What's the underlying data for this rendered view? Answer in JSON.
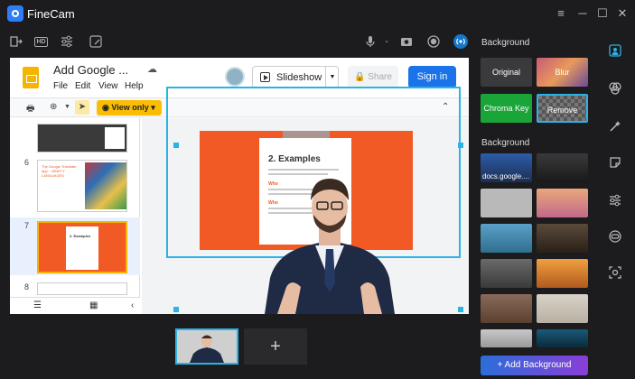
{
  "app": {
    "title": "FineCam"
  },
  "window": {
    "menu_icon": "≡",
    "minimize_icon": "─",
    "maximize_icon": "☐",
    "close_icon": "✕"
  },
  "toolbar": {
    "icons": [
      "exit-icon",
      "hd-icon",
      "adjust-icon",
      "edit-icon",
      "microphone-icon",
      "camera-icon",
      "record-icon",
      "broadcast-icon"
    ],
    "hd_label": "HD"
  },
  "slides_app": {
    "doc_title": "Add Google ...",
    "menu": [
      "File",
      "Edit",
      "View",
      "Help"
    ],
    "slideshow_label": "Slideshow",
    "share_label": "Share",
    "signin_label": "Sign in",
    "view_only_label": "View only",
    "thumbnails": [
      {
        "number": "6",
        "text": "The Google Translate app... NINETY LANGUAGES"
      },
      {
        "number": "7",
        "text": "2. Examples"
      },
      {
        "number": "8",
        "text": ""
      }
    ],
    "slide": {
      "heading": "2. Examples",
      "bullet_1": "Who",
      "bullet_2": "Who"
    }
  },
  "strip": {
    "add_label": "+"
  },
  "panel": {
    "section_background": "Background",
    "options": {
      "original": "Original",
      "blur": "Blur",
      "chroma_key": "Chroma Key",
      "remove": "Remove"
    },
    "section_library": "Background",
    "first_tile_label": "docs.google....",
    "add_background_label": "+ Add Background"
  },
  "colors": {
    "accent": "#2bb3e6",
    "slides_orange": "#f15a24",
    "chroma_green": "#1aa539",
    "signin_blue": "#1a73e8",
    "view_only_yellow": "#fbbc04"
  }
}
